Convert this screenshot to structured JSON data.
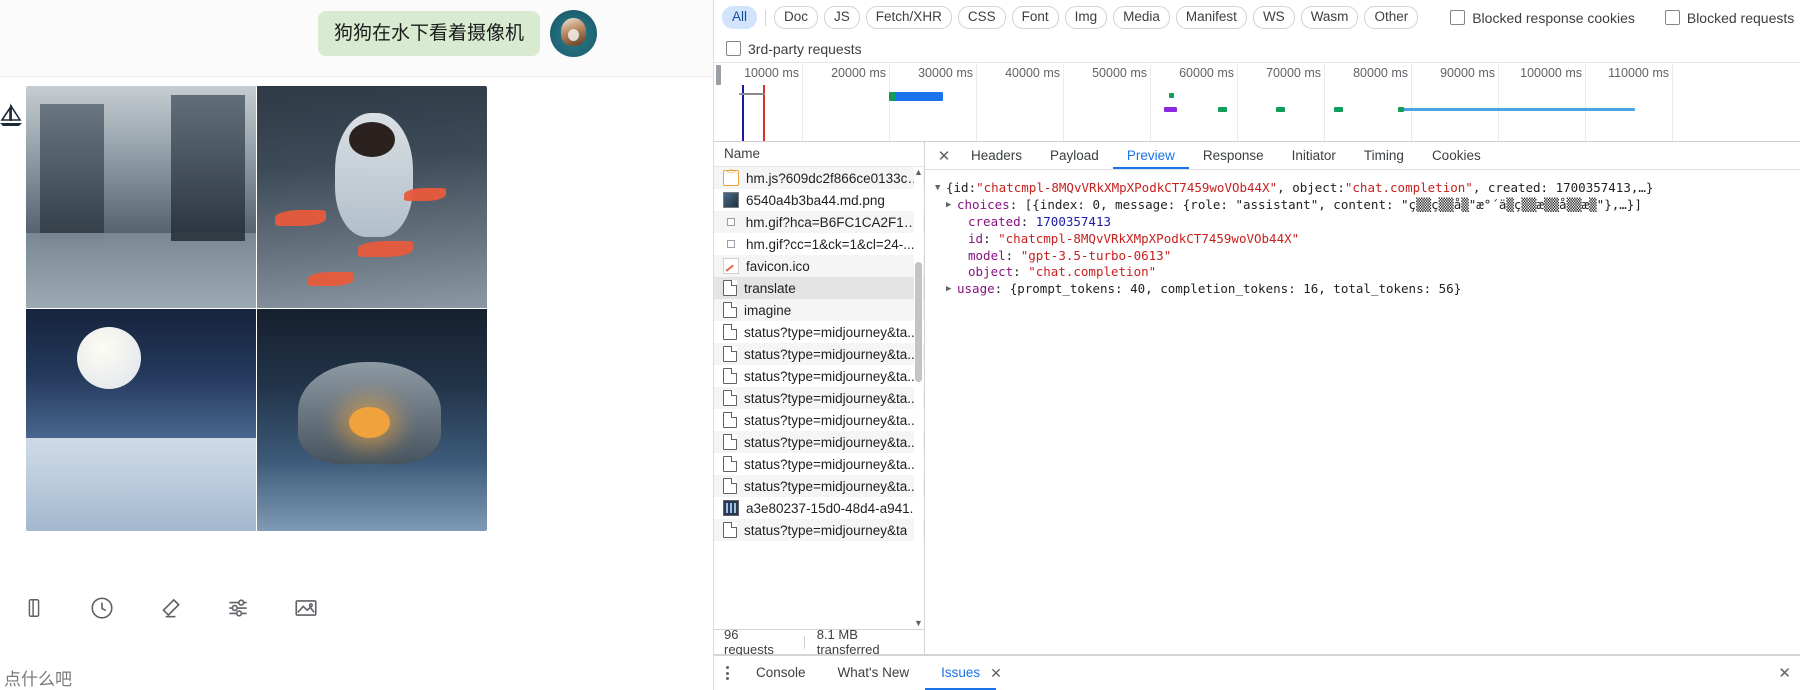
{
  "webapp": {
    "chat_message": "狗狗在水下看着摄像机",
    "avatar": "dog-avatar",
    "footer_text": "点什么吧",
    "toolbar_icons": [
      "panel-icon",
      "history-clock-icon",
      "eraser-icon",
      "sliders-icon",
      "image-icon"
    ],
    "logo_icon": "sail-logo-icon",
    "gallery": [
      {
        "name": "flooded-city-street"
      },
      {
        "name": "woman-with-koi-fish"
      },
      {
        "name": "moonlit-waves-pagoda"
      },
      {
        "name": "sea-monster-ship"
      }
    ]
  },
  "devtools": {
    "filters": [
      {
        "label": "All",
        "active": true
      },
      {
        "label": "Doc",
        "active": false
      },
      {
        "label": "JS",
        "active": false
      },
      {
        "label": "Fetch/XHR",
        "active": false
      },
      {
        "label": "CSS",
        "active": false
      },
      {
        "label": "Font",
        "active": false
      },
      {
        "label": "Img",
        "active": false
      },
      {
        "label": "Media",
        "active": false
      },
      {
        "label": "Manifest",
        "active": false
      },
      {
        "label": "WS",
        "active": false
      },
      {
        "label": "Wasm",
        "active": false
      },
      {
        "label": "Other",
        "active": false
      }
    ],
    "checkboxes": [
      {
        "label": "Blocked response cookies",
        "checked": false
      },
      {
        "label": "Blocked requests",
        "checked": false
      },
      {
        "label": "3rd-party requests",
        "checked": false
      }
    ],
    "overview": {
      "ticks": [
        "10000 ms",
        "20000 ms",
        "30000 ms",
        "40000 ms",
        "50000 ms",
        "60000 ms",
        "70000 ms",
        "80000 ms",
        "90000 ms",
        "100000 ms",
        "110000 ms"
      ],
      "dom_content_loaded_color": "#1a1aa6",
      "load_color": "#d93025",
      "bar_color": "#1a73e8"
    },
    "request_list": {
      "column_header": "Name",
      "rows": [
        {
          "name": "hm.js?609dc2f866ce0133cd...",
          "icon": "js-icon",
          "selected": false
        },
        {
          "name": "6540a4b3ba44.md.png",
          "icon": "image-icon",
          "selected": false
        },
        {
          "name": "hm.gif?hca=B6FC1CA2F18A...",
          "icon": "small-dot-icon",
          "selected": false
        },
        {
          "name": "hm.gif?cc=1&ck=1&cl=24-...",
          "icon": "small-dot-icon",
          "selected": false
        },
        {
          "name": "favicon.ico",
          "icon": "favicon-icon",
          "selected": false
        },
        {
          "name": "translate",
          "icon": "doc-icon",
          "selected": true
        },
        {
          "name": "imagine",
          "icon": "doc-icon",
          "selected": false
        },
        {
          "name": "status?type=midjourney&ta...",
          "icon": "doc-icon",
          "selected": false
        },
        {
          "name": "status?type=midjourney&ta...",
          "icon": "doc-icon",
          "selected": false
        },
        {
          "name": "status?type=midjourney&ta...",
          "icon": "doc-icon",
          "selected": false
        },
        {
          "name": "status?type=midjourney&ta...",
          "icon": "doc-icon",
          "selected": false
        },
        {
          "name": "status?type=midjourney&ta...",
          "icon": "doc-icon",
          "selected": false
        },
        {
          "name": "status?type=midjourney&ta...",
          "icon": "doc-icon",
          "selected": false
        },
        {
          "name": "status?type=midjourney&ta...",
          "icon": "doc-icon",
          "selected": false
        },
        {
          "name": "status?type=midjourney&ta...",
          "icon": "doc-icon",
          "selected": false
        },
        {
          "name": "a3e80237-15d0-48d4-a941...",
          "icon": "binary-icon",
          "selected": false
        },
        {
          "name": "status?type=midjourney&ta",
          "icon": "doc-icon",
          "selected": false
        }
      ]
    },
    "summary": {
      "requests": "96 requests",
      "transferred": "8.1 MB transferred"
    },
    "detail_tabs": [
      {
        "label": "Headers",
        "active": false
      },
      {
        "label": "Payload",
        "active": false
      },
      {
        "label": "Preview",
        "active": true
      },
      {
        "label": "Response",
        "active": false
      },
      {
        "label": "Initiator",
        "active": false
      },
      {
        "label": "Timing",
        "active": false
      },
      {
        "label": "Cookies",
        "active": false
      }
    ],
    "preview": {
      "line0_prefix": "{id: ",
      "line0_id": "\"chatcmpl-8MQvVRkXMpXPodkCT7459woVOb44X\"",
      "line0_mid": ", object: ",
      "line0_obj": "\"chat.completion\"",
      "line0_suffix": ", created: 1700357413,…}",
      "choices_key": "choices",
      "choices_value": ": [{index: 0, message: {role: \"assistant\", content: \"ç▒▒ç▒▒å▒\"æ°´ä▒ç▒▒æ▒▒å▒▒æ▒\"},…}]",
      "created_key": "created",
      "created_value": "1700357413",
      "id_key": "id",
      "id_value": "\"chatcmpl-8MQvVRkXMpXPodkCT7459woVOb44X\"",
      "model_key": "model",
      "model_value": "\"gpt-3.5-turbo-0613\"",
      "object_key": "object",
      "object_value": "\"chat.completion\"",
      "usage_key": "usage",
      "usage_value": ": {prompt_tokens: 40, completion_tokens: 16, total_tokens: 56}"
    },
    "drawer_tabs": [
      {
        "label": "Console",
        "active": false
      },
      {
        "label": "What's New",
        "active": false
      },
      {
        "label": "Issues",
        "active": true
      }
    ],
    "close_label": "✕"
  }
}
